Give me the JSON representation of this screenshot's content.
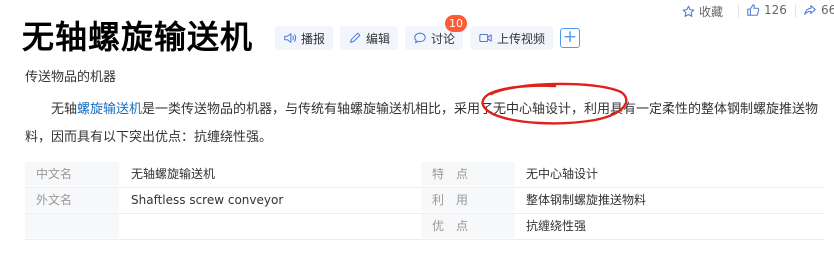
{
  "topbar": {
    "favorite_label": "收藏",
    "like_count": "126",
    "share_count": "66"
  },
  "title": "无轴螺旋输送机",
  "actions": {
    "broadcast_label": "播报",
    "edit_label": "编辑",
    "discuss_label": "讨论",
    "discuss_badge": "10",
    "upload_video_label": "上传视频",
    "add_symbol": "+"
  },
  "subtitle": "传送物品的机器",
  "paragraph": {
    "lead": "无轴",
    "link": "螺旋输送机",
    "rest": "是一类传送物品的机器，与传统有轴螺旋输送机相比，采用了无中心轴设计，利用具有一定柔性的整体钢制螺旋推送物料，因而具有以下突出优点：抗缠绕性强。"
  },
  "basic_info": {
    "left": [
      {
        "key": "中文名",
        "value": "无轴螺旋输送机"
      },
      {
        "key": "外文名",
        "value": "Shaftless screw conveyor"
      }
    ],
    "right": [
      {
        "key": "特　点",
        "value": "无中心轴设计"
      },
      {
        "key": "利　用",
        "value": "整体钢制螺旋推送物料"
      },
      {
        "key": "优　点",
        "value": "抗缠绕性强"
      }
    ]
  },
  "colors": {
    "link": "#136ec2",
    "badge": "#ff5b38",
    "annotation": "#e0201b",
    "button_bg": "#f2f5fb"
  }
}
